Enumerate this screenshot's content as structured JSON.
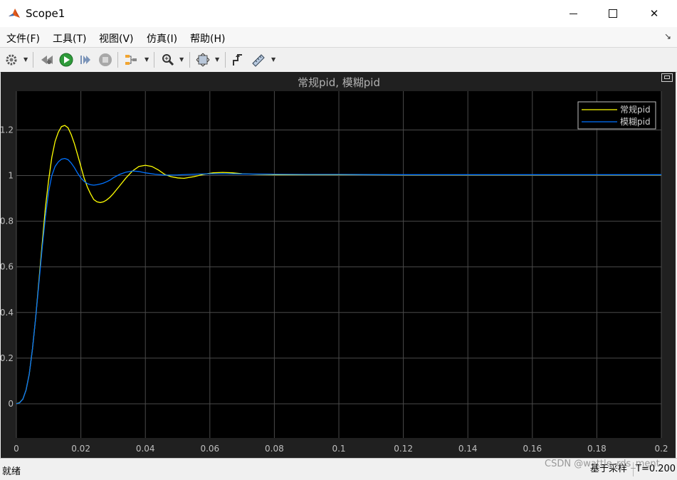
{
  "window": {
    "title": "Scope1",
    "minimize_icon": "minimize-icon",
    "maximize_icon": "maximize-icon",
    "close_icon": "close-icon"
  },
  "menu": [
    "文件(F)",
    "工具(T)",
    "视图(V)",
    "仿真(I)",
    "帮助(H)"
  ],
  "toolbar": {
    "icons": [
      "settings-gear-icon",
      "step-back-icon",
      "run-icon",
      "step-forward-icon",
      "stop-icon",
      "signal-highlight-icon",
      "zoom-icon",
      "fit-to-view-icon",
      "trigger-icon",
      "measurements-icon"
    ]
  },
  "colors": {
    "axes_bg": "#000000",
    "panel_bg": "#202020",
    "grid": "#4a4a4a",
    "tick_text": "#bfbfbf",
    "series1": "#ffff00",
    "series2": "#0072ff"
  },
  "chart_data": {
    "type": "line",
    "title": "常规pid, 模糊pid",
    "xlim": [
      0,
      0.2
    ],
    "ylim": [
      -0.15,
      1.37
    ],
    "xticks": [
      0,
      0.02,
      0.04,
      0.06,
      0.08,
      0.1,
      0.12,
      0.14,
      0.16,
      0.18,
      0.2
    ],
    "xtick_labels": [
      "0",
      "0.02",
      "0.04",
      "0.06",
      "0.08",
      "0.1",
      "0.12",
      "0.14",
      "0.16",
      "0.18",
      "0.2"
    ],
    "yticks": [
      0,
      0.2,
      0.4,
      0.6,
      0.8,
      1,
      1.2
    ],
    "ytick_labels": [
      "0",
      "0.2",
      "0.4",
      "0.6",
      "0.8",
      "1",
      "1.2"
    ],
    "grid": true,
    "legend": "top-right",
    "series": [
      {
        "name": "常规pid",
        "color": "#ffff00",
        "x": [
          0,
          0.001,
          0.002,
          0.003,
          0.004,
          0.005,
          0.006,
          0.007,
          0.008,
          0.009,
          0.01,
          0.011,
          0.012,
          0.013,
          0.014,
          0.015,
          0.016,
          0.017,
          0.018,
          0.019,
          0.02,
          0.021,
          0.022,
          0.023,
          0.024,
          0.025,
          0.026,
          0.027,
          0.028,
          0.029,
          0.03,
          0.032,
          0.034,
          0.036,
          0.038,
          0.04,
          0.042,
          0.044,
          0.046,
          0.048,
          0.05,
          0.052,
          0.055,
          0.058,
          0.061,
          0.064,
          0.067,
          0.07,
          0.075,
          0.08,
          0.09,
          0.1,
          0.12,
          0.14,
          0.16,
          0.18,
          0.2
        ],
        "y": [
          0,
          0.005,
          0.02,
          0.06,
          0.13,
          0.24,
          0.38,
          0.54,
          0.7,
          0.86,
          0.98,
          1.08,
          1.15,
          1.19,
          1.215,
          1.22,
          1.21,
          1.18,
          1.14,
          1.09,
          1.04,
          0.99,
          0.95,
          0.92,
          0.895,
          0.885,
          0.882,
          0.885,
          0.893,
          0.905,
          0.92,
          0.955,
          0.99,
          1.02,
          1.04,
          1.045,
          1.04,
          1.025,
          1.005,
          0.995,
          0.99,
          0.988,
          0.995,
          1.005,
          1.012,
          1.014,
          1.012,
          1.008,
          1.005,
          1.004,
          1.004,
          1.004,
          1.003,
          1.003,
          1.003,
          1.003,
          1.003
        ]
      },
      {
        "name": "模糊pid",
        "color": "#0072ff",
        "x": [
          0,
          0.001,
          0.002,
          0.003,
          0.004,
          0.005,
          0.006,
          0.007,
          0.008,
          0.009,
          0.01,
          0.011,
          0.012,
          0.013,
          0.014,
          0.015,
          0.016,
          0.017,
          0.018,
          0.019,
          0.02,
          0.021,
          0.022,
          0.023,
          0.024,
          0.025,
          0.026,
          0.027,
          0.028,
          0.029,
          0.03,
          0.032,
          0.034,
          0.036,
          0.038,
          0.04,
          0.043,
          0.046,
          0.05,
          0.055,
          0.06,
          0.065,
          0.07,
          0.08,
          0.09,
          0.1,
          0.12,
          0.14,
          0.16,
          0.18,
          0.2
        ],
        "y": [
          0,
          0.004,
          0.02,
          0.06,
          0.13,
          0.24,
          0.38,
          0.53,
          0.68,
          0.82,
          0.93,
          1.0,
          1.04,
          1.06,
          1.072,
          1.075,
          1.07,
          1.055,
          1.035,
          1.01,
          0.99,
          0.975,
          0.965,
          0.96,
          0.958,
          0.96,
          0.963,
          0.967,
          0.973,
          0.98,
          0.99,
          1.005,
          1.015,
          1.02,
          1.018,
          1.012,
          1.006,
          1.002,
          1.003,
          1.006,
          1.008,
          1.008,
          1.007,
          1.006,
          1.005,
          1.005,
          1.004,
          1.004,
          1.004,
          1.004,
          1.004
        ]
      }
    ]
  },
  "status": {
    "left": "就绪",
    "mode": "基于采样",
    "time": "T=0.200"
  },
  "watermark": "CSDN @wattle_rds_ment"
}
